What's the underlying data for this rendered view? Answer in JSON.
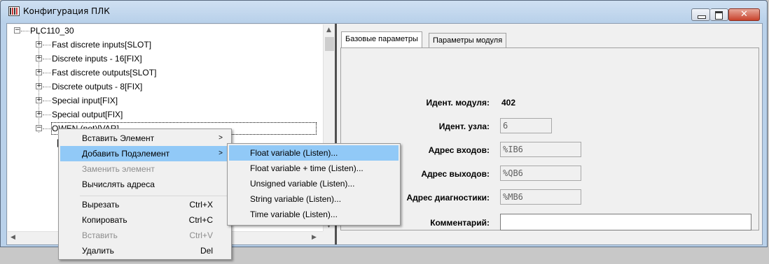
{
  "window": {
    "title": "Конфигурация ПЛК"
  },
  "tree": {
    "root": "PLC110_30",
    "items": [
      "Fast discrete inputs[SLOT]",
      "Discrete inputs - 16[FIX]",
      "Fast discrete outputs[SLOT]",
      "Discrete outputs - 8[FIX]",
      "Special input[FIX]",
      "Special output[FIX]",
      "OWEN (net)[VAR]"
    ]
  },
  "tabs": [
    "Базовые параметры",
    "Параметры модуля"
  ],
  "params": {
    "module_id_label": "Идент. модуля:",
    "module_id_value": "402",
    "node_id_label": "Идент. узла:",
    "node_id_value": "6",
    "inputs_label": "Адрес входов:",
    "inputs_value": "%IB6",
    "outputs_label": "Адрес выходов:",
    "outputs_value": "%QB6",
    "diag_label": "Адрес диагностики:",
    "diag_value": "%MB6",
    "comment_label": "Комментарий:",
    "comment_value": ""
  },
  "context_menu": {
    "items": [
      {
        "label": "Вставить Элемент",
        "shortcut": "",
        "submenu": true
      },
      {
        "label": "Добавить Подэлемент",
        "shortcut": "",
        "submenu": true
      },
      {
        "label": "Заменить элемент",
        "shortcut": ""
      },
      {
        "label": "Вычислять адреса",
        "shortcut": ""
      },
      {
        "label": "Вырезать",
        "shortcut": "Ctrl+X"
      },
      {
        "label": "Копировать",
        "shortcut": "Ctrl+C"
      },
      {
        "label": "Вставить",
        "shortcut": "Ctrl+V"
      },
      {
        "label": "Удалить",
        "shortcut": "Del"
      }
    ]
  },
  "submenu": {
    "items": [
      "Float variable (Listen)...",
      "Float variable + time (Listen)...",
      "Unsigned variable (Listen)...",
      "String variable (Listen)...",
      "Time variable (Listen)..."
    ]
  },
  "icons": [
    "app-icon",
    "minimize-icon",
    "maximize-icon",
    "close-icon",
    "expand-icon",
    "submenu-arrow-icon",
    "scroll-up-icon",
    "scroll-down-icon",
    "scroll-left-icon",
    "scroll-right-icon"
  ],
  "colors": {
    "highlight": "#91c9f7",
    "close_button": "#c8422c"
  }
}
